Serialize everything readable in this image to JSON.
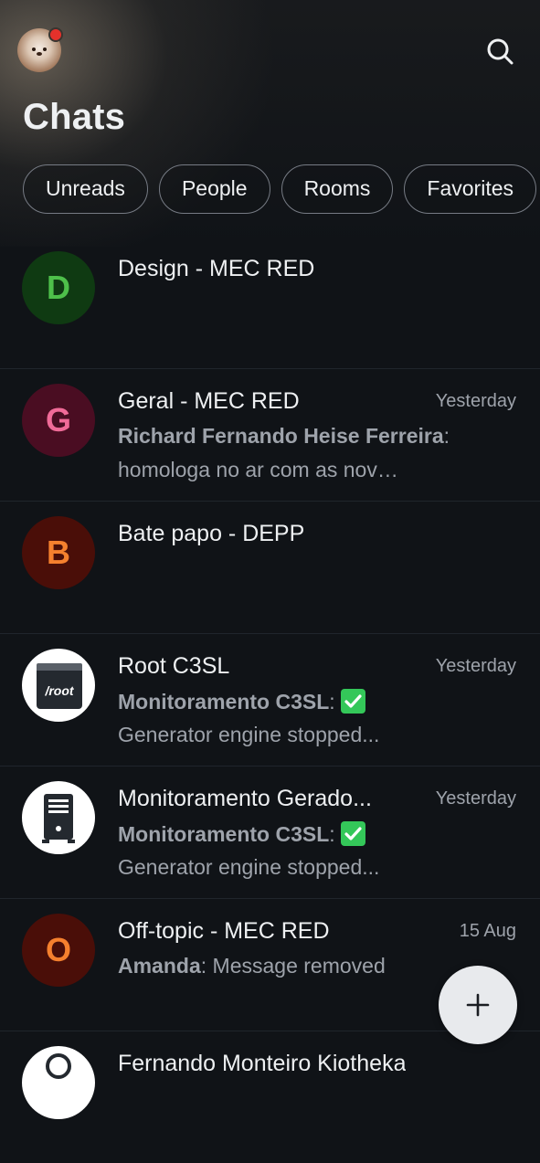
{
  "header": {
    "title": "Chats",
    "avatar_icon": "user-avatar-dog",
    "search_icon": "search-icon",
    "notification_color": "#e5312b"
  },
  "filters": [
    "Unreads",
    "People",
    "Rooms",
    "Favorites"
  ],
  "rooms": [
    {
      "name": "Design - MEC RED",
      "initial": "D",
      "avatar_bg": "#0f3a12",
      "avatar_fg": "#4ec04a",
      "time": "",
      "sender": "",
      "message": "",
      "preview": ""
    },
    {
      "name": "Geral - MEC RED",
      "initial": "G",
      "avatar_bg": "#4a0d22",
      "avatar_fg": "#f06b98",
      "time": "Yesterday",
      "sender": "Richard Fernando Heise Ferreira",
      "message": ":",
      "preview": "homologa no ar com as novas r..."
    },
    {
      "name": "Bate papo - DEPP",
      "initial": "B",
      "avatar_bg": "#4a0e08",
      "avatar_fg": "#f5802e",
      "time": "",
      "sender": "",
      "message": "",
      "preview": ""
    },
    {
      "name": "Root C3SL",
      "initial": "",
      "avatar_icon": "root-terminal-icon",
      "avatar_text": "/root",
      "time": "Yesterday",
      "sender": "Monitoramento C3SL",
      "message": ":",
      "checkmark": true,
      "preview": "Generator engine stopped..."
    },
    {
      "name": "Monitoramento Gerado...",
      "initial": "",
      "avatar_icon": "server-tower-icon",
      "time": "Yesterday",
      "sender": "Monitoramento C3SL",
      "message": ":",
      "checkmark": true,
      "preview": "Generator engine stopped..."
    },
    {
      "name": "Off-topic - MEC RED",
      "initial": "O",
      "avatar_bg": "#4a0e08",
      "avatar_fg": "#f5802e",
      "time": "15 Aug",
      "sender": "Amanda",
      "message": ": Message removed",
      "preview": ""
    },
    {
      "name": "Fernando Monteiro Kiotheka",
      "initial": "",
      "time": "",
      "sender": "",
      "message": "",
      "preview": ""
    }
  ],
  "fab": {
    "icon": "plus-icon"
  }
}
